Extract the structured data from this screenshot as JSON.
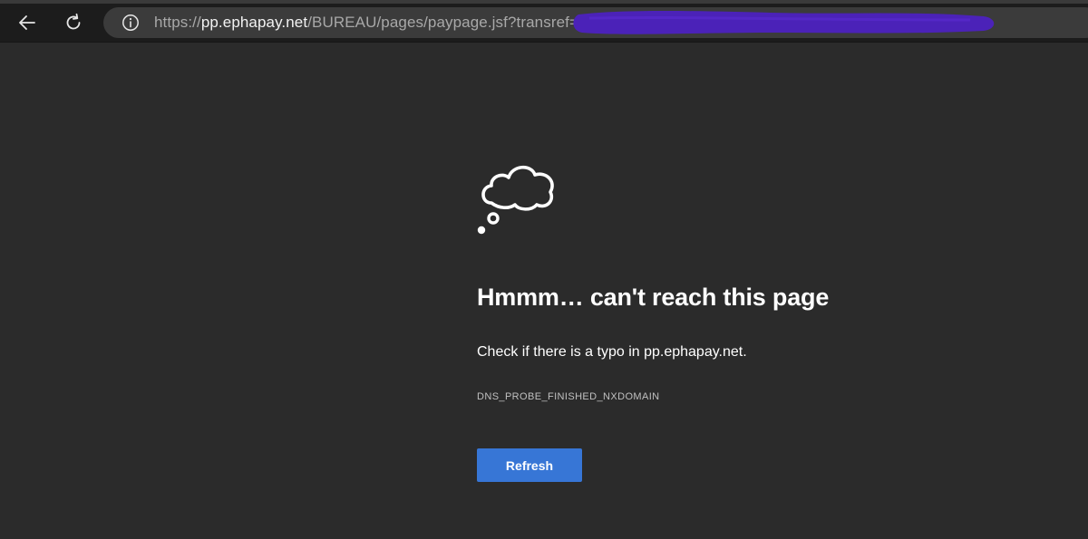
{
  "address_bar": {
    "url_scheme": "https://",
    "url_host": "pp.ephapay.net",
    "url_path": "/BUREAU/pages/paypage.jsf?transref="
  },
  "error_page": {
    "title": "Hmmm… can't reach this page",
    "message": "Check if there is a typo in pp.ephapay.net.",
    "error_code": "DNS_PROBE_FINISHED_NXDOMAIN",
    "refresh_label": "Refresh"
  },
  "icons": {
    "back": "back-arrow-icon",
    "reload": "reload-icon",
    "site_info": "info-icon",
    "illustration": "thought-cloud-icon"
  },
  "colors": {
    "page_background": "#2b2b2b",
    "toolbar_background": "#1c1c1c",
    "address_bar_background": "#3b3b3b",
    "button_blue": "#3776d6",
    "redaction_purple": "#4b22b8"
  }
}
